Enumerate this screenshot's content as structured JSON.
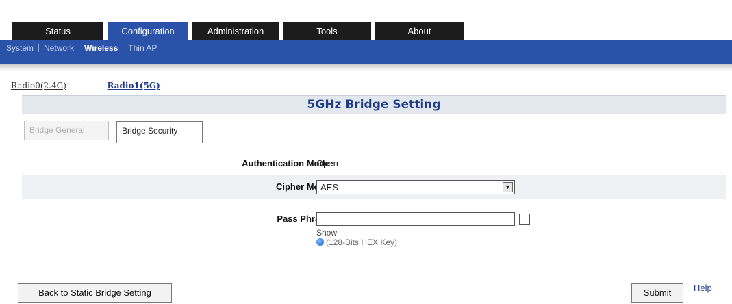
{
  "top_tabs": [
    {
      "label": "Status",
      "active": false
    },
    {
      "label": "Configuration",
      "active": true
    },
    {
      "label": "Administration",
      "active": false
    },
    {
      "label": "Tools",
      "active": false
    },
    {
      "label": "About",
      "active": false
    }
  ],
  "subnav": [
    {
      "label": "System",
      "active": false
    },
    {
      "label": "Network",
      "active": false
    },
    {
      "label": "Wireless",
      "active": true
    },
    {
      "label": "Thin AP",
      "active": false
    }
  ],
  "radio_links": {
    "radio0": "Radio0(2.4G)",
    "separator": "-",
    "radio1": "Radio1(5G)"
  },
  "page_title": "5GHz Bridge Setting",
  "sub_tabs": {
    "general": "Bridge General",
    "security": "Bridge Security"
  },
  "form": {
    "auth_mode": {
      "label": "Authentication Mode:",
      "value": "Open"
    },
    "cipher_mode": {
      "label": "Cipher Mode:",
      "value": "AES"
    },
    "pass_phrase": {
      "label": "Pass Phrase:",
      "value": "",
      "show_label": "Show",
      "hint": "(128-Bits HEX Key)"
    }
  },
  "buttons": {
    "back": "Back to Static Bridge Setting",
    "submit": "Submit",
    "help": "Help"
  },
  "colors": {
    "nav_blue": "#2a52a8",
    "tab_dark": "#1c1c1c",
    "title_blue": "#1f3c88"
  }
}
